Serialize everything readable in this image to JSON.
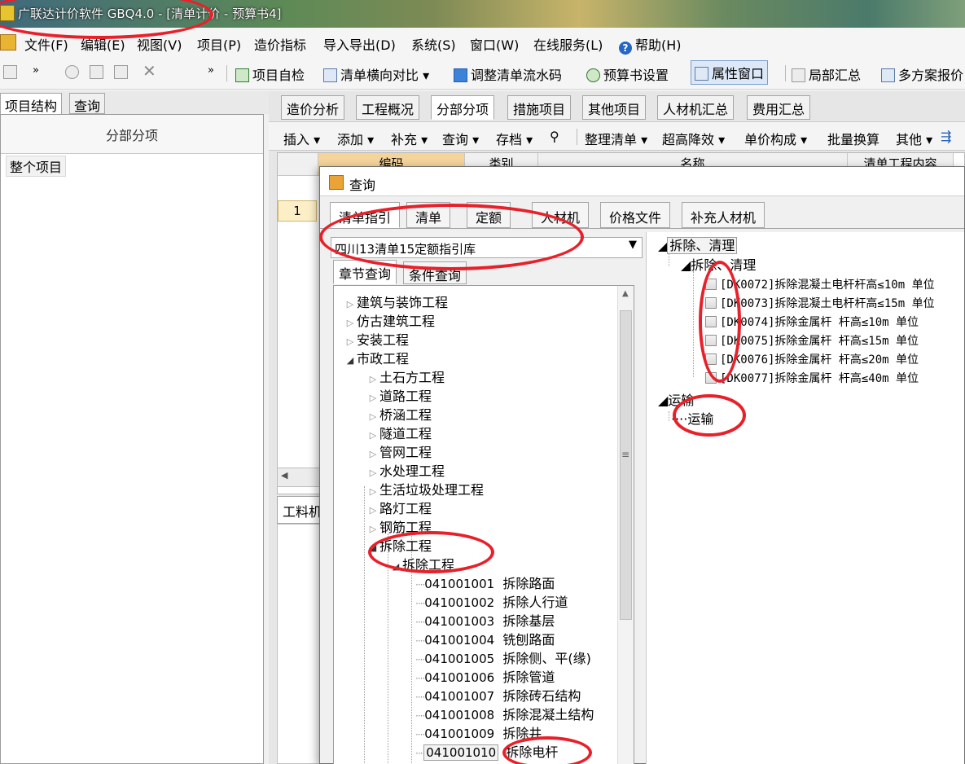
{
  "window": {
    "title": "广联达计价软件 GBQ4.0 - [清单计价 - 预算书4]"
  },
  "menubar": {
    "items": [
      "文件(F)",
      "编辑(E)",
      "视图(V)",
      "项目(P)",
      "造价指标",
      "导入导出(D)",
      "系统(S)",
      "窗口(W)",
      "在线服务(L)",
      "帮助(H)"
    ]
  },
  "toolbar": {
    "items": [
      "项目自检",
      "清单横向对比",
      "调整清单流水码",
      "预算书设置",
      "属性窗口",
      "局部汇总",
      "多方案报价"
    ]
  },
  "left_panel": {
    "tabs": [
      "项目结构",
      "查询"
    ],
    "header": "分部分项",
    "root_item": "整个项目"
  },
  "main_tabs": [
    "造价分析",
    "工程概况",
    "分部分项",
    "措施项目",
    "其他项目",
    "人材机汇总",
    "费用汇总"
  ],
  "main_toolbar": [
    "插入",
    "添加",
    "补充",
    "查询",
    "存档",
    "整理清单",
    "超高降效",
    "单价构成",
    "批量换算",
    "其他"
  ],
  "grid": {
    "columns": [
      "编码",
      "类别",
      "名称",
      "清单工程内容"
    ],
    "row_number": "1",
    "row_label": "整个项目"
  },
  "bottom_tab": "工料机",
  "dialog": {
    "title": "查询",
    "tabs": [
      "清单指引",
      "清单",
      "定额",
      "人材机",
      "价格文件",
      "补充人材机"
    ],
    "library": "四川13清单15定额指引库",
    "search_tabs": [
      "章节查询",
      "条件查询"
    ],
    "tree": {
      "top": [
        "建筑与装饰工程",
        "仿古建筑工程",
        "安装工程",
        "市政工程"
      ],
      "municipal_children": [
        "土石方工程",
        "道路工程",
        "桥涵工程",
        "隧道工程",
        "管网工程",
        "水处理工程",
        "生活垃圾处理工程",
        "路灯工程",
        "钢筋工程",
        "拆除工程"
      ],
      "demolition_sub": "拆除工程",
      "items": [
        {
          "code": "041001001",
          "name": "拆除路面"
        },
        {
          "code": "041001002",
          "name": "拆除人行道"
        },
        {
          "code": "041001003",
          "name": "拆除基层"
        },
        {
          "code": "041001004",
          "name": "铣刨路面"
        },
        {
          "code": "041001005",
          "name": "拆除侧、平(缘)"
        },
        {
          "code": "041001006",
          "name": "拆除管道"
        },
        {
          "code": "041001007",
          "name": "拆除砖石结构"
        },
        {
          "code": "041001008",
          "name": "拆除混凝土结构"
        },
        {
          "code": "041001009",
          "name": "拆除井"
        },
        {
          "code": "041001010",
          "name": "拆除电杆"
        }
      ]
    },
    "right_tree": {
      "group1": "拆除、清理",
      "group1_child": "拆除、清理",
      "quotas": [
        "[DK0072]拆除混凝土电杆杆高≤10m 单位",
        "[DK0073]拆除混凝土电杆杆高≤15m 单位",
        "[DK0074]拆除金属杆 杆高≤10m 单位",
        "[DK0075]拆除金属杆 杆高≤15m 单位",
        "[DK0076]拆除金属杆 杆高≤20m 单位",
        "[DK0077]拆除金属杆 杆高≤40m 单位"
      ],
      "group2": "运输",
      "group2_child": "运输"
    }
  },
  "colors": {
    "annotation": "#e8202a",
    "selected_row": "#fcefc8"
  }
}
